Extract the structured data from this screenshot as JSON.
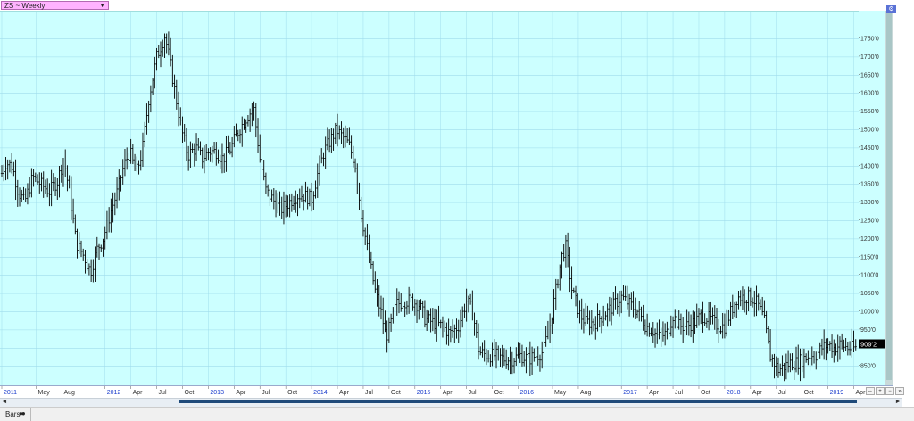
{
  "header": {
    "symbol_label": "ZS ~ Weekly"
  },
  "status": {
    "mode_label": "Bars"
  },
  "last_price_label": "909'2",
  "colors": {
    "plot_bg": "#ccffff",
    "grid": "#9fdcec",
    "bar": "#000000",
    "year_label": "#1a3ccc",
    "price_tag": "#000000"
  },
  "chart_data": {
    "type": "ohlc",
    "ylim": [
      810,
      1810
    ],
    "y_ticks": [
      850,
      900,
      950,
      1000,
      1050,
      1100,
      1150,
      1200,
      1250,
      1300,
      1350,
      1400,
      1450,
      1500,
      1550,
      1600,
      1650,
      1700,
      1750
    ],
    "y_tick_labels": [
      "850'0",
      "",
      "950'0",
      "1000'0",
      "1050'0",
      "1100'0",
      "1150'0",
      "1200'0",
      "1250'0",
      "1300'0",
      "1350'0",
      "1400'0",
      "1450'0",
      "1500'0",
      "1550'0",
      "1600'0",
      "1650'0",
      "1700'0",
      "1750'0"
    ],
    "x_labels": [
      {
        "t": 2011.0,
        "label": "2011",
        "year": true
      },
      {
        "t": 2011.333,
        "label": "May",
        "year": false
      },
      {
        "t": 2011.583,
        "label": "Aug",
        "year": false
      },
      {
        "t": 2012.0,
        "label": "2012",
        "year": true
      },
      {
        "t": 2012.25,
        "label": "Apr",
        "year": false
      },
      {
        "t": 2012.5,
        "label": "Jul",
        "year": false
      },
      {
        "t": 2012.75,
        "label": "Oct",
        "year": false
      },
      {
        "t": 2013.0,
        "label": "2013",
        "year": true
      },
      {
        "t": 2013.25,
        "label": "Apr",
        "year": false
      },
      {
        "t": 2013.5,
        "label": "Jul",
        "year": false
      },
      {
        "t": 2013.75,
        "label": "Oct",
        "year": false
      },
      {
        "t": 2014.0,
        "label": "2014",
        "year": true
      },
      {
        "t": 2014.25,
        "label": "Apr",
        "year": false
      },
      {
        "t": 2014.5,
        "label": "Jul",
        "year": false
      },
      {
        "t": 2014.75,
        "label": "Oct",
        "year": false
      },
      {
        "t": 2015.0,
        "label": "2015",
        "year": true
      },
      {
        "t": 2015.25,
        "label": "Apr",
        "year": false
      },
      {
        "t": 2015.5,
        "label": "Jul",
        "year": false
      },
      {
        "t": 2015.75,
        "label": "Oct",
        "year": false
      },
      {
        "t": 2016.0,
        "label": "2016",
        "year": true
      },
      {
        "t": 2016.333,
        "label": "May",
        "year": false
      },
      {
        "t": 2016.583,
        "label": "Aug",
        "year": false
      },
      {
        "t": 2017.0,
        "label": "2017",
        "year": true
      },
      {
        "t": 2017.25,
        "label": "Apr",
        "year": false
      },
      {
        "t": 2017.5,
        "label": "Jul",
        "year": false
      },
      {
        "t": 2017.75,
        "label": "Oct",
        "year": false
      },
      {
        "t": 2018.0,
        "label": "2018",
        "year": true
      },
      {
        "t": 2018.25,
        "label": "Apr",
        "year": false
      },
      {
        "t": 2018.5,
        "label": "Jul",
        "year": false
      },
      {
        "t": 2018.75,
        "label": "Oct",
        "year": false
      },
      {
        "t": 2019.0,
        "label": "2019",
        "year": true
      },
      {
        "t": 2019.25,
        "label": "Apr",
        "year": false
      }
    ],
    "x_range": [
      2011.0,
      2019.28
    ],
    "last_price": 909.25,
    "anchors": [
      [
        2011.0,
        1380
      ],
      [
        2011.04,
        1410
      ],
      [
        2011.1,
        1400
      ],
      [
        2011.16,
        1330
      ],
      [
        2011.22,
        1300
      ],
      [
        2011.3,
        1370
      ],
      [
        2011.38,
        1350
      ],
      [
        2011.46,
        1330
      ],
      [
        2011.54,
        1360
      ],
      [
        2011.6,
        1420
      ],
      [
        2011.66,
        1320
      ],
      [
        2011.72,
        1190
      ],
      [
        2011.8,
        1150
      ],
      [
        2011.86,
        1110
      ],
      [
        2011.92,
        1170
      ],
      [
        2011.98,
        1200
      ],
      [
        2012.06,
        1280
      ],
      [
        2012.12,
        1330
      ],
      [
        2012.18,
        1400
      ],
      [
        2012.24,
        1440
      ],
      [
        2012.3,
        1380
      ],
      [
        2012.36,
        1440
      ],
      [
        2012.42,
        1580
      ],
      [
        2012.5,
        1700
      ],
      [
        2012.58,
        1760
      ],
      [
        2012.62,
        1700
      ],
      [
        2012.68,
        1600
      ],
      [
        2012.74,
        1500
      ],
      [
        2012.8,
        1430
      ],
      [
        2012.88,
        1450
      ],
      [
        2012.94,
        1420
      ],
      [
        2013.0,
        1440
      ],
      [
        2013.08,
        1440
      ],
      [
        2013.14,
        1420
      ],
      [
        2013.22,
        1450
      ],
      [
        2013.28,
        1490
      ],
      [
        2013.36,
        1530
      ],
      [
        2013.44,
        1560
      ],
      [
        2013.5,
        1420
      ],
      [
        2013.56,
        1330
      ],
      [
        2013.62,
        1310
      ],
      [
        2013.7,
        1280
      ],
      [
        2013.78,
        1300
      ],
      [
        2013.86,
        1320
      ],
      [
        2013.92,
        1320
      ],
      [
        2014.0,
        1310
      ],
      [
        2014.06,
        1380
      ],
      [
        2014.12,
        1440
      ],
      [
        2014.18,
        1470
      ],
      [
        2014.24,
        1500
      ],
      [
        2014.3,
        1480
      ],
      [
        2014.36,
        1460
      ],
      [
        2014.42,
        1410
      ],
      [
        2014.48,
        1270
      ],
      [
        2014.56,
        1140
      ],
      [
        2014.62,
        1050
      ],
      [
        2014.68,
        990
      ],
      [
        2014.72,
        930
      ],
      [
        2014.76,
        960
      ],
      [
        2014.82,
        1020
      ],
      [
        2014.9,
        1030
      ],
      [
        2014.96,
        1030
      ],
      [
        2015.04,
        1020
      ],
      [
        2015.1,
        980
      ],
      [
        2015.18,
        970
      ],
      [
        2015.26,
        960
      ],
      [
        2015.34,
        940
      ],
      [
        2015.42,
        960
      ],
      [
        2015.5,
        1030
      ],
      [
        2015.56,
        1000
      ],
      [
        2015.62,
        890
      ],
      [
        2015.7,
        880
      ],
      [
        2015.78,
        880
      ],
      [
        2015.86,
        870
      ],
      [
        2015.94,
        870
      ],
      [
        2016.02,
        880
      ],
      [
        2016.1,
        870
      ],
      [
        2016.18,
        880
      ],
      [
        2016.24,
        890
      ],
      [
        2016.3,
        950
      ],
      [
        2016.36,
        1050
      ],
      [
        2016.42,
        1150
      ],
      [
        2016.46,
        1180
      ],
      [
        2016.52,
        1060
      ],
      [
        2016.6,
        990
      ],
      [
        2016.66,
        970
      ],
      [
        2016.74,
        970
      ],
      [
        2016.82,
        990
      ],
      [
        2016.9,
        1010
      ],
      [
        2017.0,
        1040
      ],
      [
        2017.08,
        1020
      ],
      [
        2017.16,
        1000
      ],
      [
        2017.24,
        960
      ],
      [
        2017.3,
        950
      ],
      [
        2017.36,
        930
      ],
      [
        2017.44,
        940
      ],
      [
        2017.5,
        990
      ],
      [
        2017.56,
        960
      ],
      [
        2017.62,
        960
      ],
      [
        2017.7,
        970
      ],
      [
        2017.78,
        990
      ],
      [
        2017.86,
        980
      ],
      [
        2017.94,
        960
      ],
      [
        2018.0,
        960
      ],
      [
        2018.06,
        1000
      ],
      [
        2018.12,
        1040
      ],
      [
        2018.2,
        1040
      ],
      [
        2018.26,
        1040
      ],
      [
        2018.32,
        1020
      ],
      [
        2018.38,
        980
      ],
      [
        2018.44,
        880
      ],
      [
        2018.52,
        840
      ],
      [
        2018.58,
        850
      ],
      [
        2018.64,
        860
      ],
      [
        2018.7,
        860
      ],
      [
        2018.76,
        870
      ],
      [
        2018.82,
        880
      ],
      [
        2018.88,
        880
      ],
      [
        2018.94,
        900
      ],
      [
        2019.0,
        910
      ],
      [
        2019.06,
        900
      ],
      [
        2019.12,
        910
      ],
      [
        2019.2,
        900
      ],
      [
        2019.26,
        900
      ]
    ]
  }
}
